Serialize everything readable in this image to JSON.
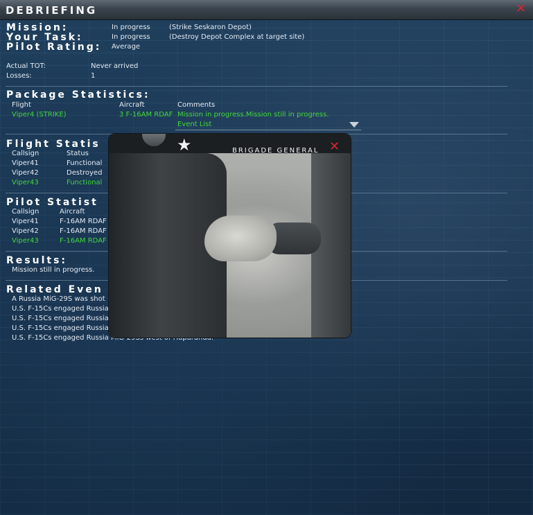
{
  "window": {
    "title": "DEBRIEFING"
  },
  "summary": {
    "mission_label": "Mission:",
    "mission_status": "In progress",
    "mission_detail": "(Strike Seskaron Depot)",
    "task_label": "Your Task:",
    "task_status": "In progress",
    "task_detail": "(Destroy Depot Complex at target site)",
    "rating_label": "Pilot Rating:",
    "rating_value": "Average",
    "tot_label": "Actual TOT:",
    "tot_value": "Never arrived",
    "losses_label": "Losses:",
    "losses_value": "1"
  },
  "package": {
    "header": "Package Statistics:",
    "col_flight": "Flight",
    "col_aircraft": "Aircraft",
    "col_comments": "Comments",
    "flight": "Viper4 (STRIKE)",
    "aircraft": "3 F-16AM RDAF",
    "comments": "Mission in progress.Mission still in progress.",
    "event_list": "Event List"
  },
  "flight_stats": {
    "header": "Flight Statis",
    "col_callsign": "Callsign",
    "col_status": "Status",
    "rows": [
      {
        "callsign": "Viper41",
        "status": "Functional"
      },
      {
        "callsign": "Viper42",
        "status": "Destroyed"
      },
      {
        "callsign": "Viper43",
        "status": "Functional"
      }
    ]
  },
  "pilot_stats": {
    "header": "Pilot Statist",
    "col_callsign": "Callsign",
    "col_aircraft": "Aircraft",
    "rows": [
      {
        "callsign": "Viper41",
        "aircraft": "F-16AM RDAF"
      },
      {
        "callsign": "Viper42",
        "aircraft": "F-16AM RDAF"
      },
      {
        "callsign": "Viper43",
        "aircraft": "F-16AM RDAF"
      }
    ]
  },
  "results": {
    "header": "Results:",
    "text": "Mission still in progress."
  },
  "events": {
    "header": "Related Even",
    "items": [
      "A Russia MiG-29S was shot",
      "U.S. F-15Cs engaged Russia",
      "U.S. F-15Cs engaged Russia",
      "U.S. F-15Cs engaged Russia",
      "U.S. F-15Cs engaged Russia MiG-29Ss west of Haparanda."
    ]
  },
  "popup": {
    "rank": "BRIGADE GENERAL"
  },
  "colors": {
    "highlight_green": "#43d53a",
    "close_red": "#d8262a"
  }
}
